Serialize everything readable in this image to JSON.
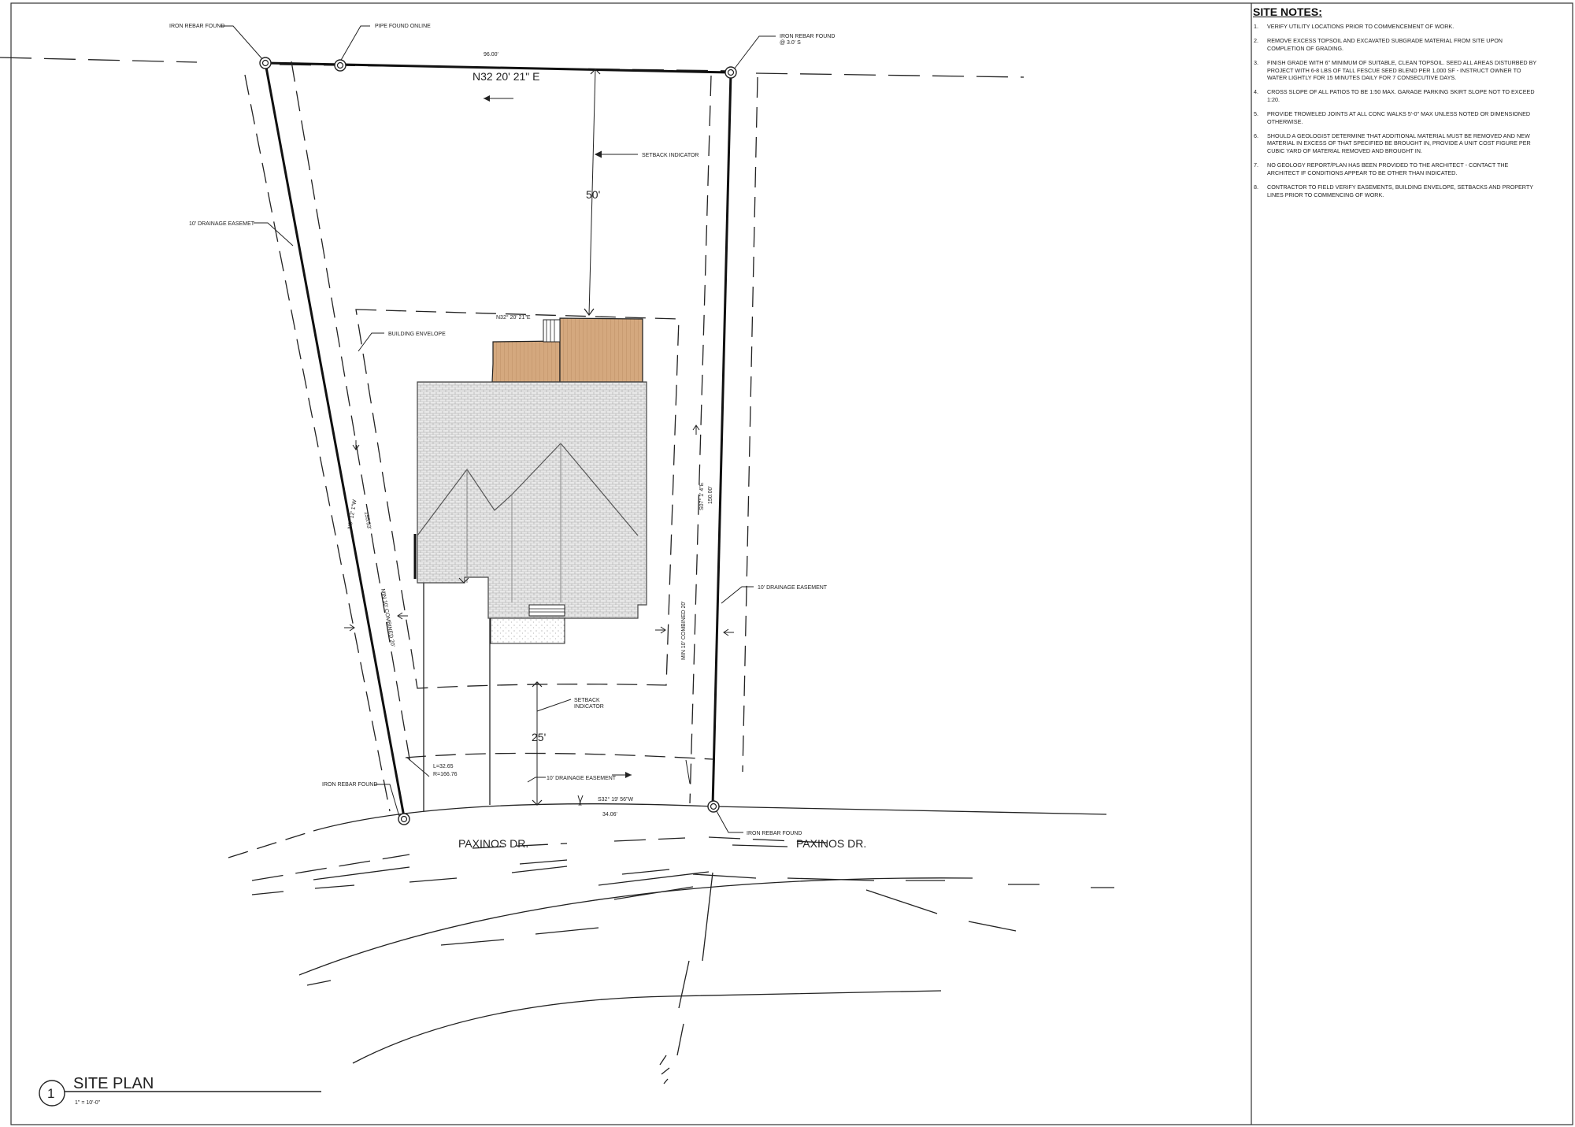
{
  "drawing": {
    "title": "SITE PLAN",
    "number": "1",
    "scale": "1\" = 10'-0\""
  },
  "labels": {
    "iron_rebar_nw": "IRON REBAR FOUND",
    "pipe_found": "PIPE FOUND ONLINE",
    "iron_rebar_ne_line1": "IRON REBAR FOUND",
    "iron_rebar_ne_line2": "@ 3.0' S",
    "north_distance": "96.00'",
    "north_bearing": "N32 20' 21\" E",
    "setback_indicator_top": "SETBACK INDICATOR",
    "setback_top_value": "50'",
    "drainage_easement_west": "10' DRAINAGE  EASEMET",
    "building_envelope": "BUILDING ENVELOPE",
    "envelope_bearing": "N32° 20' 21\"E",
    "west_bearing": "N8° 12' 1\"W",
    "west_distance": "155.53'",
    "west_side_setback": "MIN 10'  COMBINED 20'",
    "east_bearing": "S07° 1' 4\"E",
    "east_distance": "150.00'",
    "east_side_setback": "MIN 10' COMBINED 20'",
    "drainage_easement_east": "10' DRAINAGE EASEMENT",
    "setback_bottom_line1": "SETBACK",
    "setback_bottom_line2": "INDICATOR",
    "setback_bottom_value": "25'",
    "drainage_easement_south": "10' DRAINAGE EASEMENT",
    "curve_length": "L=32.65",
    "curve_radius": "R=166.76",
    "iron_rebar_sw": "IRON REBAR FOUND",
    "south_bearing": "S32° 19' 56\"W",
    "south_distance": "34.06'",
    "iron_rebar_se": "IRON REBAR FOUND",
    "road_west": "PAXINOS DR.",
    "road_east": "PAXINOS DR."
  },
  "site_notes": {
    "title": "SITE NOTES:",
    "items": [
      {
        "num": "1.",
        "text": "VERIFY UTILITY LOCATIONS PRIOR TO COMMENCEMENT OF WORK."
      },
      {
        "num": "2.",
        "text": "REMOVE EXCESS TOPSOIL AND EXCAVATED SUBGRADE MATERIAL FROM SITE UPON COMPLETION OF GRADING."
      },
      {
        "num": "3.",
        "text": "FINISH GRADE WITH 6\" MINIMUM OF SUITABLE, CLEAN TOPSOIL. SEED ALL AREAS DISTURBED BY PROJECT WITH 6-8 LBS OF TALL FESCUE SEED BLEND PER 1,000 SF - INSTRUCT OWNER TO WATER LIGHTLY FOR 15 MINUTES DAILY FOR 7 CONSECUTIVE DAYS."
      },
      {
        "num": "4.",
        "text": "CROSS SLOPE OF ALL PATIOS TO BE 1:50 MAX. GARAGE PARKING SKIRT SLOPE NOT TO EXCEED 1:20."
      },
      {
        "num": "5.",
        "text": "PROVIDE TROWELED JOINTS AT ALL CONC WALKS 5'-0\" MAX UNLESS NOTED OR DIMENSIONED OTHERWISE."
      },
      {
        "num": "6.",
        "text": "SHOULD A GEOLOGIST DETERMINE THAT ADDITIONAL MATERIAL MUST BE REMOVED AND NEW MATERIAL IN EXCESS OF THAT SPECIFIED BE BROUGHT IN, PROVIDE A UNIT COST FIGURE PER CUBIC YARD OF MATERIAL REMOVED AND BROUGHT IN."
      },
      {
        "num": "7.",
        "text": "NO GEOLOGY REPORT/PLAN HAS BEEN PROVIDED TO THE ARCHITECT - CONTACT THE ARCHITECT IF CONDITIONS APPEAR TO BE OTHER THAN INDICATED."
      },
      {
        "num": "8.",
        "text": "CONTRACTOR TO FIELD VERIFY EASEMENTS, BUILDING ENVELOPE, SETBACKS AND PROPERTY LINES PRIOR TO COMMENCING OF WORK."
      }
    ]
  },
  "colors": {
    "deck": "#d4a87e",
    "roof": "#e6e6e6",
    "line": "#222222"
  }
}
